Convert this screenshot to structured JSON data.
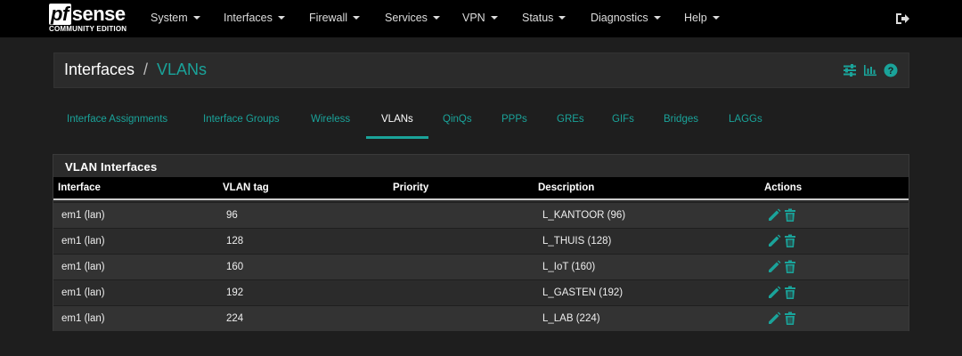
{
  "brand": {
    "name": "sense",
    "prefix": "pf",
    "edition": "COMMUNITY EDITION"
  },
  "nav": {
    "items": [
      "System",
      "Interfaces",
      "Firewall",
      "Services",
      "VPN",
      "Status",
      "Diagnostics",
      "Help"
    ],
    "logout_icon": "sign-out-icon"
  },
  "header": {
    "section": "Interfaces",
    "separator": "/",
    "page": "VLANs",
    "icons": [
      "sliders-icon",
      "bar-chart-icon",
      "help-icon"
    ]
  },
  "tabs": {
    "items": [
      "Interface Assignments",
      "Interface Groups",
      "Wireless",
      "VLANs",
      "QinQs",
      "PPPs",
      "GREs",
      "GIFs",
      "Bridges",
      "LAGGs"
    ],
    "active": "VLANs"
  },
  "panel": {
    "title": "VLAN Interfaces",
    "columns": [
      "Interface",
      "VLAN tag",
      "Priority",
      "Description",
      "Actions"
    ],
    "rows": [
      {
        "interface": "em1 (lan)",
        "tag": "96",
        "priority": "",
        "description": "L_KANTOOR (96)"
      },
      {
        "interface": "em1 (lan)",
        "tag": "128",
        "priority": "",
        "description": "L_THUIS (128)"
      },
      {
        "interface": "em1 (lan)",
        "tag": "160",
        "priority": "",
        "description": "L_IoT (160)"
      },
      {
        "interface": "em1 (lan)",
        "tag": "192",
        "priority": "",
        "description": "L_GASTEN (192)"
      },
      {
        "interface": "em1 (lan)",
        "tag": "224",
        "priority": "",
        "description": "L_LAB (224)"
      }
    ],
    "action_icons": [
      "pencil-icon",
      "trash-icon"
    ]
  },
  "colors": {
    "accent": "#1aa39a",
    "navbar": "#000000",
    "background": "#1e1e1e",
    "panel": "#2b2b2b"
  }
}
